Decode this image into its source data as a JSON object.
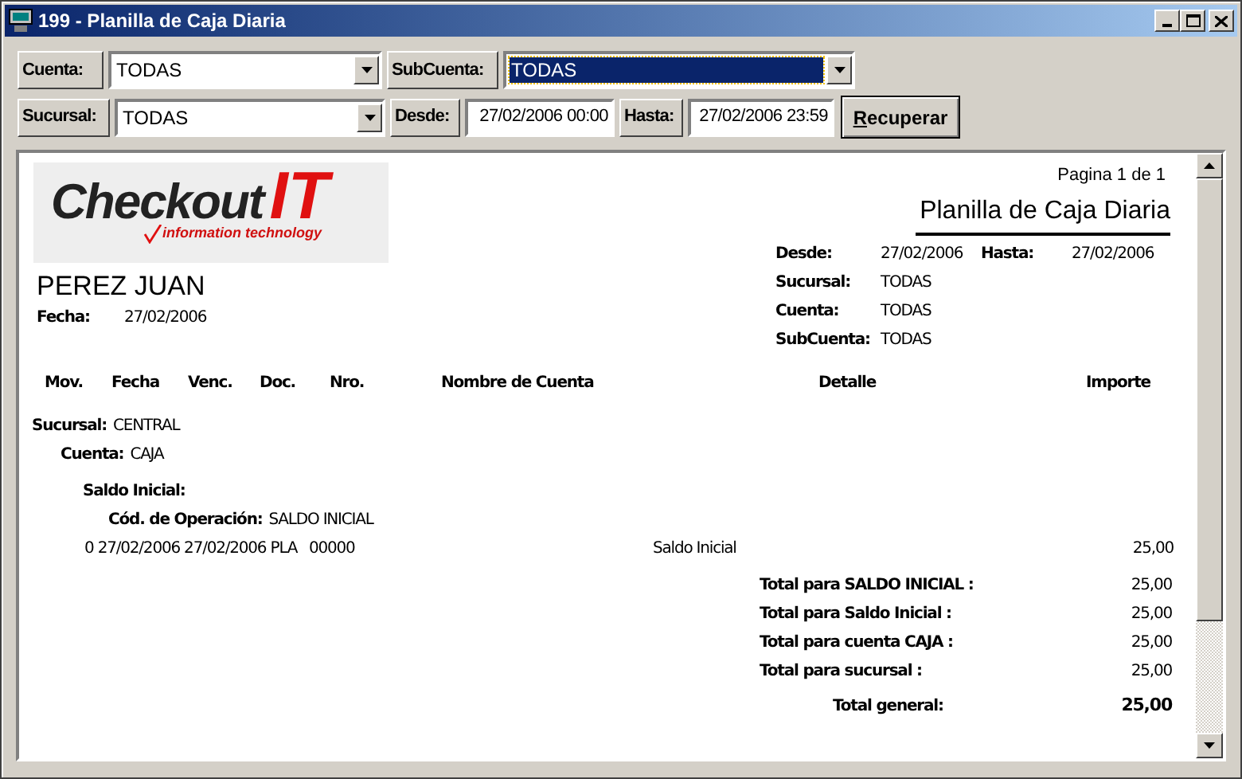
{
  "window": {
    "title": "199 - Planilla de Caja Diaria"
  },
  "filters": [
    [
      {
        "kind": "combo",
        "label": "Cuenta:",
        "value": "TODAS",
        "selected": false
      },
      {
        "kind": "combo",
        "label": "SubCuenta:",
        "value": "TODAS",
        "selected": true
      }
    ],
    [
      {
        "kind": "combo",
        "label": "Sucursal:",
        "value": "TODAS",
        "selected": false
      },
      {
        "kind": "date",
        "label": "Desde:",
        "value": "27/02/2006 00:00",
        "selected": false
      },
      {
        "kind": "date",
        "label": "Hasta:",
        "value": "27/02/2006 23:59",
        "selected": false
      },
      {
        "kind": "button",
        "label": "Recuperar",
        "selected": false
      }
    ]
  ],
  "report": {
    "logo": {
      "name": "Checkout",
      "accent": "IT",
      "tagline": "information technology"
    },
    "page": "Pagina 1 de 1",
    "title": "Planilla de Caja Diaria",
    "params": [
      [
        {
          "label": "Desde:",
          "value": "27/02/2006"
        },
        {
          "label": "Hasta:",
          "value": "27/02/2006"
        }
      ],
      [
        {
          "label": "Sucursal:",
          "value": "TODAS"
        }
      ],
      [
        {
          "label": "Cuenta:",
          "value": "TODAS"
        }
      ],
      [
        {
          "label": "SubCuenta:",
          "value": "TODAS"
        }
      ]
    ],
    "client": "PEREZ JUAN",
    "date": {
      "label": "Fecha:",
      "value": "27/02/2006"
    },
    "columns": [
      "Mov.",
      "Fecha",
      "Venc.",
      "Doc.",
      "Nro.",
      "Nombre de Cuenta",
      "Detalle",
      "Importe"
    ],
    "groups": [
      {
        "label": "Sucursal:",
        "value": "CENTRAL"
      },
      {
        "label": "Cuenta:",
        "value": "CAJA"
      },
      {
        "label": "Saldo Inicial:"
      },
      {
        "label": "Cód. de Operación:",
        "value": "SALDO INICIAL"
      }
    ],
    "rows": [
      {
        "mov": "0 27/02/2006 27/02/2006 PLA",
        "nro": "00000",
        "detalle": "Saldo Inicial",
        "importe": "25,00"
      }
    ],
    "totals": [
      {
        "kind": "sub",
        "label": "Total para SALDO INICIAL :",
        "value": "25,00"
      },
      {
        "kind": "sub",
        "label": "Total para Saldo Inicial :",
        "value": "25,00"
      },
      {
        "kind": "sub",
        "label": "Total para cuenta CAJA :",
        "value": "25,00"
      },
      {
        "kind": "sub",
        "label": "Total para sucursal  :",
        "value": "25,00"
      },
      {
        "kind": "grand",
        "label": "Total general:",
        "value": "25,00"
      }
    ]
  }
}
